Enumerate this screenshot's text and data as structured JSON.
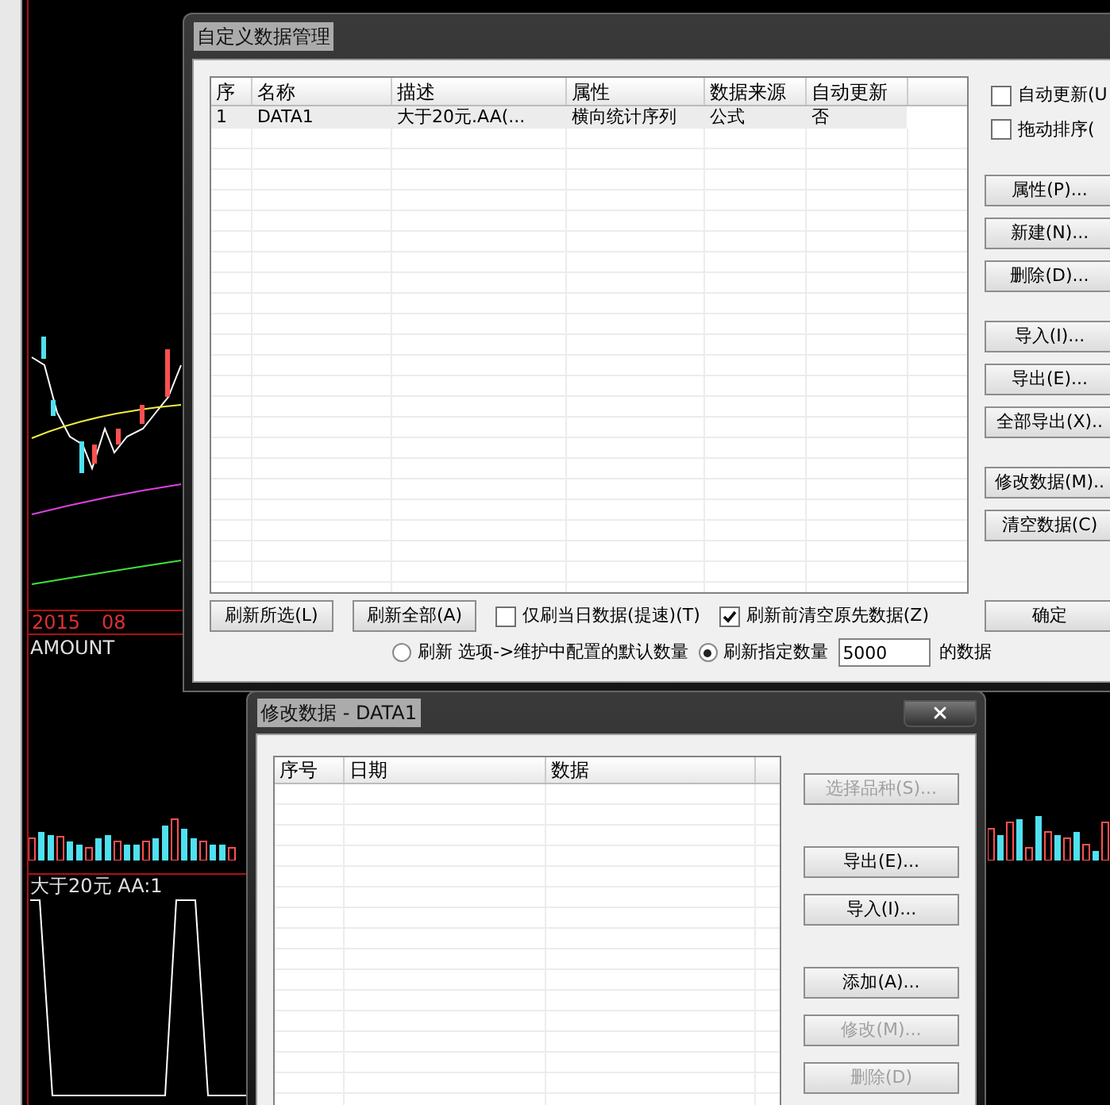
{
  "background_chart": {
    "date_labels": [
      "2015",
      "08"
    ],
    "indicator_label": "AMOUNT",
    "oscillator_label": "大于20元 AA:1"
  },
  "data_manager_dialog": {
    "title": "自定义数据管理",
    "columns": [
      "序",
      "名称",
      "描述",
      "属性",
      "数据来源",
      "自动更新"
    ],
    "rows": [
      {
        "cells": [
          "1",
          "DATA1",
          "大于20元.AA(...",
          "横向统计序列",
          "公式",
          "否"
        ],
        "selected": true
      }
    ],
    "side_options": [
      {
        "label": "自动更新(U",
        "checked": false
      },
      {
        "label": "拖动排序(",
        "checked": false
      }
    ],
    "side_button_groups": [
      [
        {
          "label": "属性(P)..."
        },
        {
          "label": "新建(N)..."
        },
        {
          "label": "删除(D)..."
        }
      ],
      [
        {
          "label": "导入(I)..."
        },
        {
          "label": "导出(E)..."
        },
        {
          "label": "全部导出(X).."
        }
      ],
      [
        {
          "label": "修改数据(M).."
        },
        {
          "label": "清空数据(C)"
        }
      ]
    ],
    "bottom_buttons": [
      "刷新所选(L)",
      "刷新全部(A)"
    ],
    "bottom_options": [
      {
        "label": "仅刷当日数据(提速)(T)",
        "checked": false
      },
      {
        "label": "刷新前清空原先数据(Z)",
        "checked": true
      }
    ],
    "ok_button": "确定",
    "refresh_modes": [
      {
        "label": "刷新 选项->维护中配置的默认数量",
        "selected": false
      },
      {
        "label": "刷新指定数量",
        "selected": true
      }
    ],
    "count_value": "5000",
    "count_suffix": "的数据"
  },
  "edit_dialog": {
    "title": "修改数据 - DATA1",
    "columns": [
      "序号",
      "日期",
      "数据"
    ],
    "button_groups": [
      [
        {
          "label": "选择品种(S)...",
          "disabled": true
        }
      ],
      [
        {
          "label": "导出(E)...",
          "disabled": false
        },
        {
          "label": "导入(I)...",
          "disabled": false
        }
      ],
      [
        {
          "label": "添加(A)...",
          "disabled": false
        },
        {
          "label": "修改(M)...",
          "disabled": true
        },
        {
          "label": "删除(D)",
          "disabled": true
        }
      ]
    ]
  }
}
